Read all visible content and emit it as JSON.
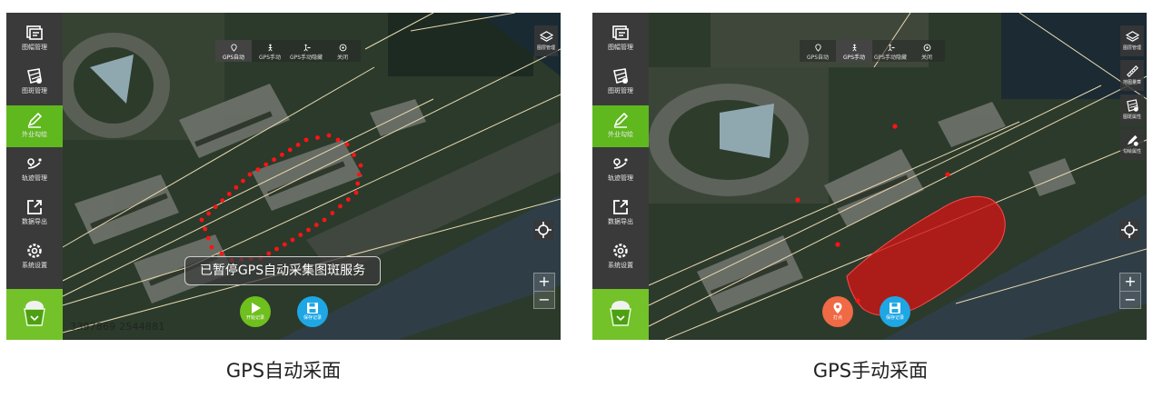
{
  "left": {
    "sidebar": [
      {
        "label": "图幅管理",
        "icon": "map-sheet-icon"
      },
      {
        "label": "图斑管理",
        "icon": "patch-icon"
      },
      {
        "label": "外业勾绘",
        "icon": "pen-icon",
        "active": true
      },
      {
        "label": "轨迹管理",
        "icon": "track-icon"
      },
      {
        "label": "数据导出",
        "icon": "export-icon"
      },
      {
        "label": "系统设置",
        "icon": "settings-icon"
      }
    ],
    "gps_tabs": [
      {
        "label": "GPS自动",
        "icon": "location-pin-icon",
        "selected": true
      },
      {
        "label": "GPS手动",
        "icon": "walker-icon"
      },
      {
        "label": "GPS手动隐藏",
        "icon": "walker-hide-icon"
      },
      {
        "label": "关闭",
        "icon": "close-circle-icon"
      }
    ],
    "right_tools": [
      {
        "label": "图层管理",
        "icon": "layers-icon"
      }
    ],
    "toast": "已暂停GPS自动采集图斑服务",
    "buttons": {
      "start": "开始记录",
      "save": "保存记录"
    },
    "coord_text": "3397869  2544881",
    "zoom": {
      "plus": "+",
      "minus": "−"
    }
  },
  "right": {
    "sidebar": [
      {
        "label": "图幅管理",
        "icon": "map-sheet-icon"
      },
      {
        "label": "图斑管理",
        "icon": "patch-icon"
      },
      {
        "label": "外业勾绘",
        "icon": "pen-icon",
        "active": true
      },
      {
        "label": "轨迹管理",
        "icon": "track-icon"
      },
      {
        "label": "数据导出",
        "icon": "export-icon"
      },
      {
        "label": "系统设置",
        "icon": "settings-icon"
      }
    ],
    "gps_tabs": [
      {
        "label": "GPS自动",
        "icon": "location-pin-icon"
      },
      {
        "label": "GPS手动",
        "icon": "walker-icon",
        "selected": true
      },
      {
        "label": "GPS手动隐藏",
        "icon": "walker-hide-icon"
      },
      {
        "label": "关闭",
        "icon": "close-circle-icon"
      }
    ],
    "right_tools": [
      {
        "label": "图层管理",
        "icon": "layers-icon"
      },
      {
        "label": "地图量算",
        "icon": "ruler-icon"
      },
      {
        "label": "图斑属性",
        "icon": "patch-attr-icon"
      },
      {
        "label": "勾绘属性",
        "icon": "draw-attr-icon"
      }
    ],
    "buttons": {
      "point": "打点",
      "save": "保存记录"
    },
    "zoom": {
      "plus": "+",
      "minus": "−"
    }
  },
  "captions": {
    "left": "GPS自动采面",
    "right": "GPS手动采面"
  },
  "colors": {
    "sidebar": "#3a3a3a",
    "active": "#5fb81e",
    "start_button": "#6fbf1e",
    "save_button": "#1ea7e4",
    "point_button": "#ef6a45",
    "track_dots": "#ff1010",
    "polygon_fill": "#d11414"
  }
}
